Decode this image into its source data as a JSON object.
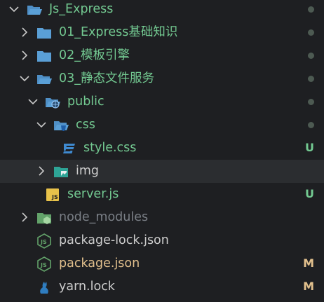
{
  "colors": {
    "background": "#1e1f22",
    "row_highlight": "#2b2d30",
    "chevron": "#c8c8c8",
    "folder_blue": "#5a9fd6",
    "folder_teal": "#2ea496",
    "node_green": "#63a36a",
    "css_blue": "#3f8ad0",
    "js_yellow": "#e8c24a",
    "yarn_blue": "#2f7dc0",
    "text_green": "#73c991",
    "text_default": "#cccccc",
    "text_dim": "#7a7f86",
    "text_modified": "#e2c08d",
    "badge_untracked": "#73c991",
    "badge_modified": "#e2c08d",
    "dot_gray": "#4d5a52"
  },
  "tree": {
    "items": [
      {
        "label": "Js_Express",
        "chevron": "down",
        "icon": "folder-open-icon",
        "status": "dot"
      },
      {
        "label": "01_Express基础知识",
        "chevron": "right",
        "icon": "folder-icon",
        "status": "dot"
      },
      {
        "label": "02_模板引擎",
        "chevron": "right",
        "icon": "folder-icon",
        "status": "dot"
      },
      {
        "label": "03_静态文件服务",
        "chevron": "down",
        "icon": "folder-open-icon",
        "status": "dot"
      },
      {
        "label": "public",
        "chevron": "down",
        "icon": "public-folder-icon",
        "status": "dot"
      },
      {
        "label": "css",
        "chevron": "down",
        "icon": "css-folder-icon",
        "status": "dot"
      },
      {
        "label": "style.css",
        "chevron": "none",
        "icon": "css-file-icon",
        "status": "U"
      },
      {
        "label": "img",
        "chevron": "right",
        "icon": "image-folder-icon",
        "status": ""
      },
      {
        "label": "server.js",
        "chevron": "none",
        "icon": "js-file-icon",
        "status": "U"
      },
      {
        "label": "node_modules",
        "chevron": "right",
        "icon": "node-modules-folder-icon",
        "status": ""
      },
      {
        "label": "package-lock.json",
        "chevron": "none",
        "icon": "node-json-icon",
        "status": ""
      },
      {
        "label": "package.json",
        "chevron": "none",
        "icon": "node-json-icon",
        "status": "M"
      },
      {
        "label": "yarn.lock",
        "chevron": "none",
        "icon": "yarn-cat-icon",
        "status": "M"
      }
    ]
  }
}
